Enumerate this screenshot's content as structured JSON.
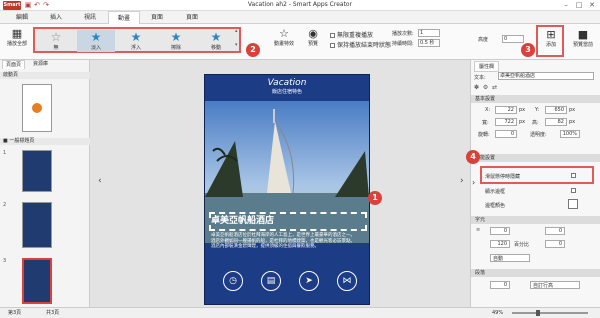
{
  "app": {
    "title": "Vacation ah2 - Smart Apps Creator",
    "logo": "Smart",
    "quick_access": [
      "save-icon",
      "undo-icon",
      "redo-icon"
    ]
  },
  "menu": {
    "tabs": [
      "編輯",
      "插入",
      "視訊",
      "動畫",
      "頁面",
      "頁面"
    ],
    "active": "動畫"
  },
  "ribbon": {
    "play_all": "播放全部",
    "effects": [
      {
        "label": "無",
        "icon": "star-outline-icon"
      },
      {
        "label": "淡入",
        "icon": "star-icon",
        "selected": true
      },
      {
        "label": "浮入",
        "icon": "star-icon"
      },
      {
        "label": "擦除",
        "icon": "star-icon"
      },
      {
        "label": "移動",
        "icon": "star-icon"
      }
    ],
    "effect_options": "動畫特效",
    "preview": "預覽",
    "opt1": "無限重複播放",
    "opt2": "保持播放結束時狀態",
    "repeat_label": "播放次數:",
    "repeat_value": "1",
    "delay_label": "持續時間:",
    "delay_value": "0.5 秒",
    "height_label": "高度",
    "height_value": "0",
    "add_label": "添加",
    "preview_anim": "預覽當前"
  },
  "badges": [
    "1",
    "2",
    "3",
    "4"
  ],
  "left_pane": {
    "tabs": [
      "頁面頁",
      "資源庫"
    ],
    "section1": "啟動頁",
    "section2": "■ 一般標題頁",
    "thumb_nums": [
      "1",
      "2",
      "3"
    ]
  },
  "phone": {
    "header_title": "Vacation",
    "header_sub": "飯店住宿特色",
    "hotel_name": "卓美亞帆船酒店",
    "desc_lines": [
      "卓美亞帆船酒店位於杜拜海岸的人工島上，是世界上最豪華的酒店之一。",
      "酒店外觀如同一艘揚帆的船，是杜拜的地標建築，也是觀光客必訪景點。",
      "酒店內部裝潢金碧輝煌，提供頂級的住宿與餐飲服務。"
    ],
    "buttons": [
      "clock-icon",
      "document-icon",
      "send-icon",
      "share-icon"
    ]
  },
  "right_pane": {
    "tab": "屬性欄",
    "text_label": "文本:",
    "text_value": "卓美亞帆船酒店",
    "basic_section": "基本設置",
    "x_label": "X:",
    "x_value": "22",
    "y_label": "Y:",
    "y_value": "650",
    "w_label": "寬:",
    "w_value": "722",
    "h_label": "高:",
    "h_value": "82",
    "rot_label": "旋轉:",
    "rot_value": "0",
    "opacity_label": "透明度:",
    "opacity_value": "100%",
    "unit": "px",
    "func_section": "功能設置",
    "func_opt": "滑鼠懸停時隱藏",
    "show_border": "顯示邊框",
    "border_color": "邊框顏色",
    "text_section": "字元",
    "para_section": "段落",
    "line_spacing": "自訂行高",
    "font_size": "120",
    "font_unit": "百分比",
    "align": "自動",
    "spacing_value": "0"
  },
  "status": {
    "page": "第3頁",
    "total": "共3頁",
    "zoom": "49%"
  }
}
